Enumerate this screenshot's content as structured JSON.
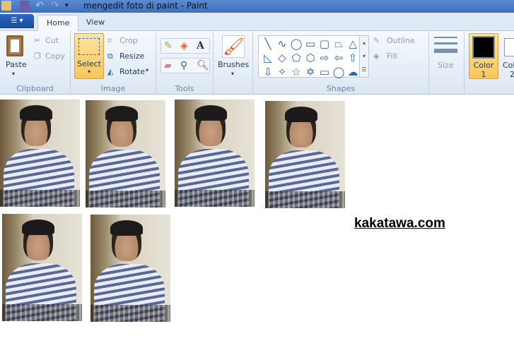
{
  "window": {
    "title": "mengedit foto di paint - Paint"
  },
  "tabs": [
    {
      "label": "Home",
      "active": true
    },
    {
      "label": "View",
      "active": false
    }
  ],
  "clipboard": {
    "paste": "Paste",
    "cut": "Cut",
    "copy": "Copy",
    "group": "Clipboard"
  },
  "image": {
    "select": "Select",
    "crop": "Crop",
    "resize": "Resize",
    "rotate": "Rotate",
    "group": "Image"
  },
  "tools": {
    "group": "Tools",
    "items": [
      "pencil-icon",
      "fill-icon",
      "text-icon",
      "eraser-icon",
      "color-picker-icon",
      "magnifier-icon"
    ]
  },
  "brushes": {
    "label": "Brushes"
  },
  "shapes": {
    "group": "Shapes",
    "outline": "Outline",
    "fill": "Fill",
    "glyphs": [
      "╲",
      "∿",
      "◯",
      "▭",
      "▢",
      "⏢",
      "△",
      "◺",
      "◇",
      "⬠",
      "⬡",
      "⇨",
      "⇦",
      "⇧",
      "⇩",
      "✧",
      "☆",
      "✡",
      "▭",
      "◯",
      "☁"
    ]
  },
  "size": {
    "label": "Size"
  },
  "colors": {
    "color1": "Color 1",
    "color1_line1": "Color",
    "color1_line2": "1",
    "color2_partial": "Col",
    "color2_line2": "2",
    "color1_value": "#000000",
    "color2_value": "#ffffff",
    "accent": "#f8c55b"
  },
  "canvas": {
    "watermark": "kakatawa.com",
    "photo_count": 6
  }
}
